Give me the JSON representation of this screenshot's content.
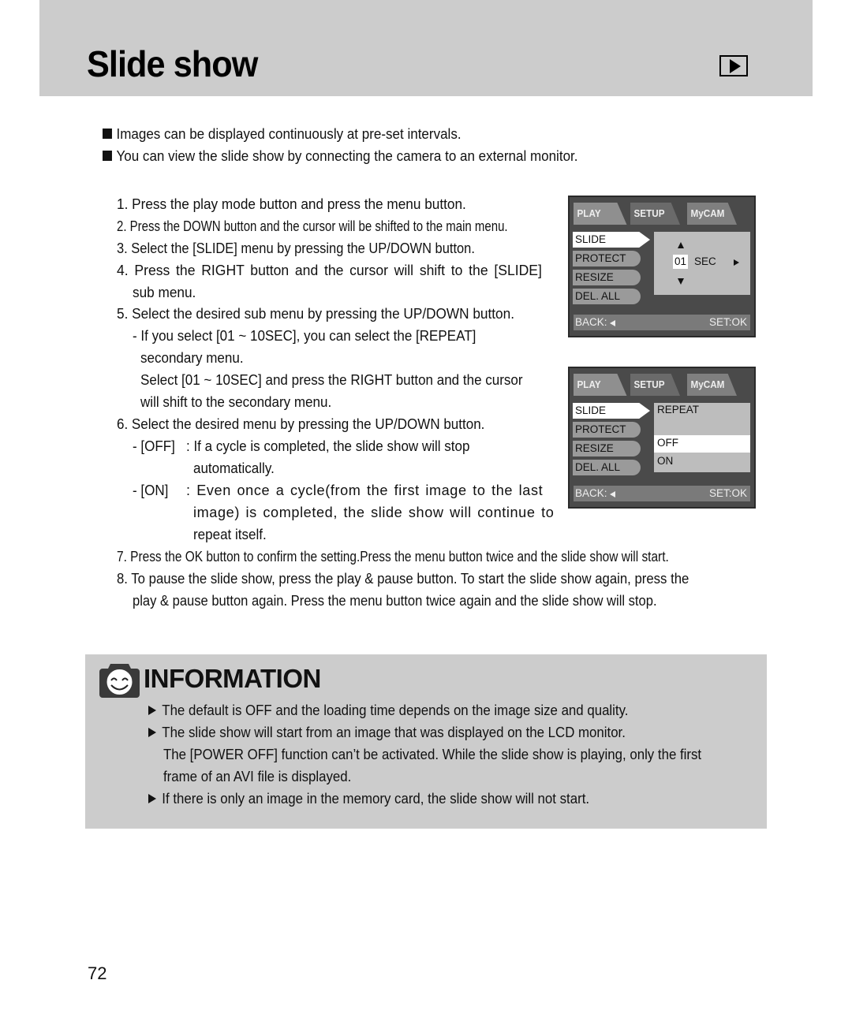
{
  "header": {
    "title": "Slide show",
    "mode_icon": "play-mode-icon"
  },
  "intro": [
    "Images can be displayed continuously at pre-set intervals.",
    "You can view the slide show by connecting the camera to an external monitor."
  ],
  "steps": {
    "s1": "1. Press the play mode button and press the menu button.",
    "s2": "2. Press the DOWN button and the cursor will be shifted to the main menu.",
    "s3": "3. Select the [SLIDE] menu by pressing the UP/DOWN button.",
    "s4a": "4. Press the RIGHT button and the cursor will shift to the [SLIDE]",
    "s4b": "sub menu.",
    "s5": "5. Select the desired sub menu by pressing the UP/DOWN button.",
    "s5a": "- If you select [01 ~ 10SEC], you can select the [REPEAT]",
    "s5b": "secondary menu.",
    "s5c": "Select [01 ~ 10SEC] and press the RIGHT button and the cursor",
    "s5d": "will shift to the secondary menu.",
    "s6": "6. Select the desired menu by pressing the UP/DOWN button.",
    "s6_off_label": "- [OFF]",
    "s6_off_a": ": If a cycle is completed, the slide show will stop",
    "s6_off_b": "automatically.",
    "s6_on_label": "- [ON]",
    "s6_on_a": ": Even once a cycle(from the first image to the last",
    "s6_on_b": "image) is completed, the slide show will continue to",
    "s6_on_c": "repeat itself.",
    "s7": "7. Press the OK button to confirm the setting.Press the menu button twice and the slide show will start.",
    "s8a": "8. To pause the slide show, press the play & pause button. To start the slide show again, press the",
    "s8b": "play & pause button again. Press the menu button twice again and the slide show will stop."
  },
  "lcd1": {
    "tabs": [
      "PLAY",
      "SETUP",
      "MyCAM"
    ],
    "menu": [
      "SLIDE",
      "PROTECT",
      "RESIZE",
      "DEL. ALL"
    ],
    "selected_menu": "SLIDE",
    "interval_value": "01",
    "interval_unit": "SEC",
    "back_label": "BACK:",
    "set_label": "SET:OK"
  },
  "lcd2": {
    "tabs": [
      "PLAY",
      "SETUP",
      "MyCAM"
    ],
    "menu": [
      "SLIDE",
      "PROTECT",
      "RESIZE",
      "DEL. ALL"
    ],
    "selected_menu": "SLIDE",
    "submenu_title": "REPEAT",
    "options": [
      "OFF",
      "ON"
    ],
    "selected_option": "OFF",
    "back_label": "BACK:",
    "set_label": "SET:OK"
  },
  "information": {
    "title": "INFORMATION",
    "icon": "smiling-camera-icon",
    "items": [
      "The default is OFF and the loading time depends on the image size and quality.",
      "The slide show will start from an image that was displayed on the LCD monitor.",
      "The [POWER OFF] function can’t be activated. While the slide show is playing, only the first",
      "frame of an AVI file is displayed.",
      "If there is only an image in the memory card, the slide show will not start."
    ]
  },
  "page_number": "72"
}
